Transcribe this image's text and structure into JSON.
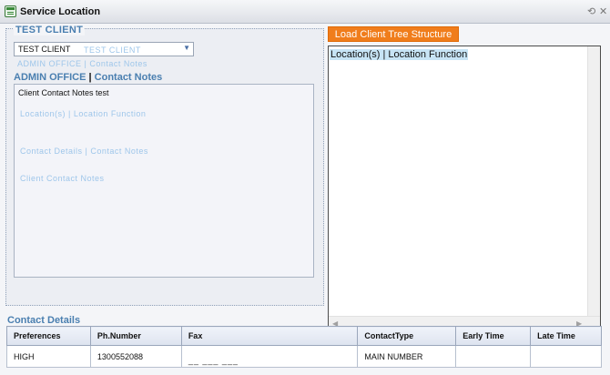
{
  "window": {
    "title": "Service Location"
  },
  "client_panel": {
    "legend": "TEST CLIENT",
    "selected_client": "TEST CLIENT",
    "office_label": "ADMIN OFFICE",
    "separator": "|",
    "notes_label": "Contact Notes",
    "notes_text": "Client Contact Notes test",
    "ghost_text": [
      "TEST CLIENT",
      "ADMIN OFFICE | Contact Notes",
      "Location(s) | Location Function",
      "Contact Details | Contact Notes",
      "Client Contact Notes"
    ]
  },
  "tree_panel": {
    "load_button": "Load Client Tree Structure",
    "header": "Location(s) | Location Function"
  },
  "contact_details": {
    "title": "Contact Details",
    "columns": [
      "Preferences",
      "Ph.Number",
      "Fax",
      "ContactType",
      "Early Time",
      "Late Time"
    ],
    "rows": [
      {
        "preferences": "HIGH",
        "phone": "1300552088",
        "fax": "__ ___ ___",
        "contact_type": "MAIN NUMBER",
        "early_time": "",
        "late_time": ""
      }
    ]
  },
  "icons": {
    "app": "grid-window-icon",
    "refresh": "refresh-icon",
    "close": "close-icon"
  }
}
